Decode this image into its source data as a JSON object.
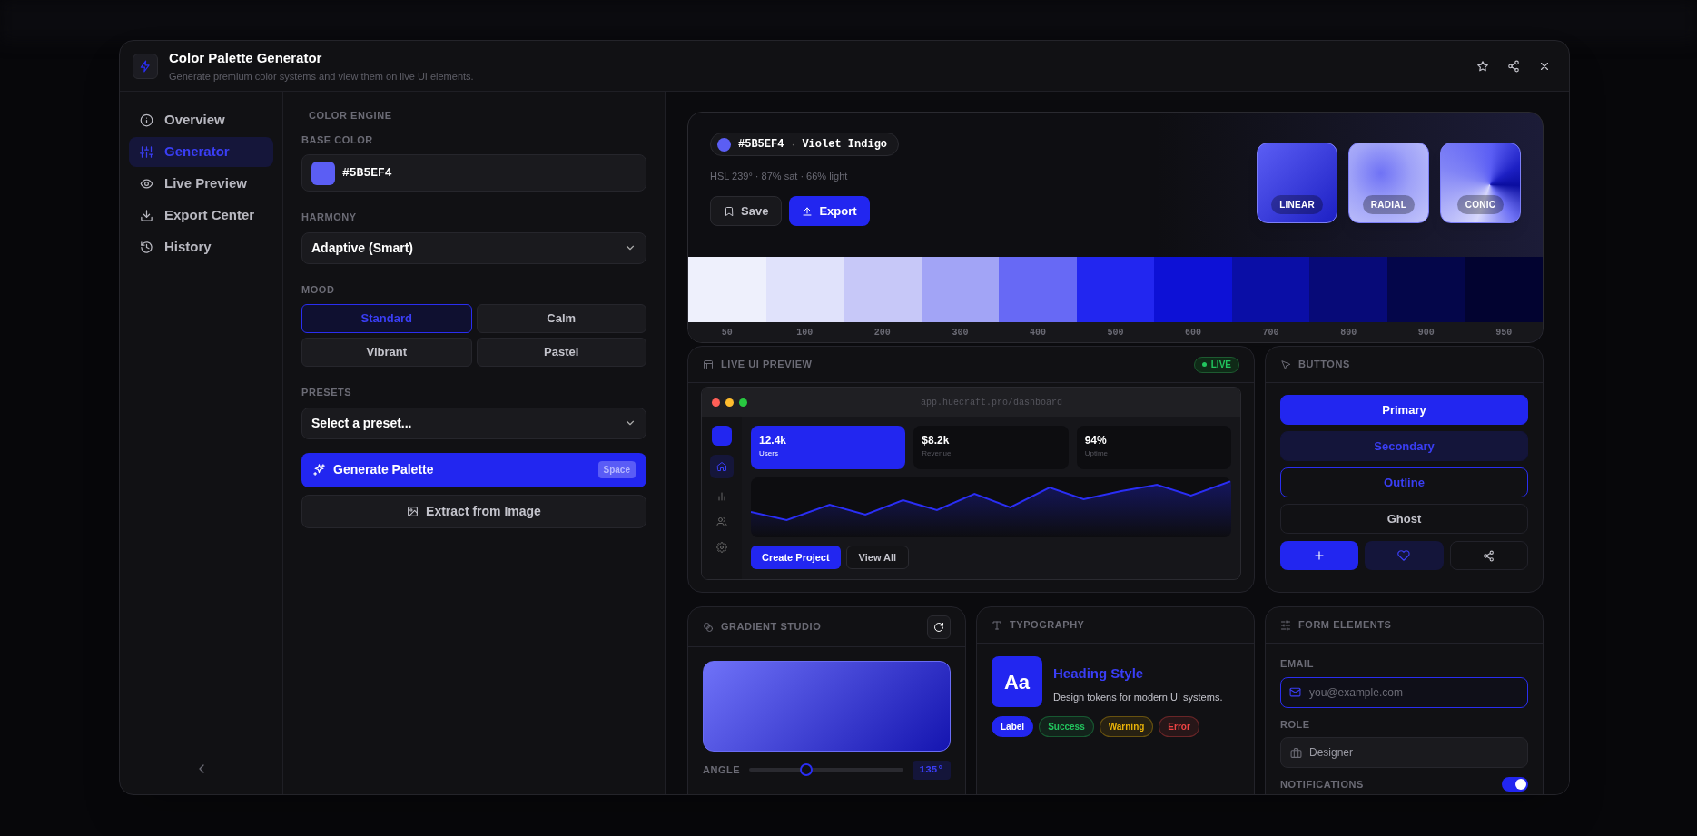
{
  "window": {
    "title": "Color Palette Generator",
    "subtitle": "Generate premium color systems and view them on live UI elements."
  },
  "sidebar": {
    "items": [
      {
        "label": "Overview",
        "selected": false
      },
      {
        "label": "Generator",
        "selected": true
      },
      {
        "label": "Live Preview",
        "selected": false
      },
      {
        "label": "Export Center",
        "selected": false
      },
      {
        "label": "History",
        "selected": false
      }
    ]
  },
  "controls": {
    "section_title": "COLOR ENGINE",
    "base_color": {
      "label": "BASE COLOR",
      "value": "#5B5EF4",
      "color": "#5b5ef4"
    },
    "harmony": {
      "label": "HARMONY",
      "value": "Adaptive (Smart)"
    },
    "mood": {
      "label": "MOOD",
      "options": [
        {
          "label": "Standard",
          "selected": true
        },
        {
          "label": "Calm",
          "selected": false
        },
        {
          "label": "Vibrant",
          "selected": false
        },
        {
          "label": "Pastel",
          "selected": false
        }
      ]
    },
    "presets": {
      "label": "PRESETS",
      "value": "Select a preset..."
    },
    "generate_button": {
      "label": "Generate Palette",
      "shortcut": "Space"
    },
    "extract_button": {
      "label": "Extract from Image"
    }
  },
  "hero": {
    "chip": {
      "hex": "#5B5EF4",
      "separator": "·",
      "name": "Violet Indigo",
      "color": "#5b5ef4"
    },
    "hsl": "HSL 239° · 87% sat · 66% light",
    "save_button": "Save",
    "export_button": "Export",
    "gradients": [
      {
        "label": "LINEAR",
        "kind": "linear"
      },
      {
        "label": "RADIAL",
        "kind": "radial"
      },
      {
        "label": "CONIC",
        "kind": "conic"
      }
    ],
    "shades": [
      {
        "label": "50",
        "color": "#eef0fc"
      },
      {
        "label": "100",
        "color": "#e0e2fb"
      },
      {
        "label": "200",
        "color": "#c7c8f8"
      },
      {
        "label": "300",
        "color": "#a2a4f6"
      },
      {
        "label": "400",
        "color": "#6769f5"
      },
      {
        "label": "500",
        "color": "#2226f0"
      },
      {
        "label": "600",
        "color": "#0d11d6"
      },
      {
        "label": "700",
        "color": "#0a0ea6"
      },
      {
        "label": "800",
        "color": "#070a78"
      },
      {
        "label": "900",
        "color": "#04064a"
      },
      {
        "label": "950",
        "color": "#020330"
      }
    ]
  },
  "live_preview": {
    "title": "LIVE UI PREVIEW",
    "badge": "LIVE",
    "url": "app.huecraft.pro/dashboard",
    "stats": [
      {
        "value": "12.4k",
        "label": "Users",
        "selected": true
      },
      {
        "value": "$8.2k",
        "label": "Revenue",
        "selected": false
      },
      {
        "value": "94%",
        "label": "Uptime",
        "selected": false
      }
    ],
    "primary_button": "Create Project",
    "secondary_button": "View All"
  },
  "buttons_card": {
    "title": "BUTTONS",
    "buttons": [
      {
        "label": "Primary",
        "kind": "primary"
      },
      {
        "label": "Secondary",
        "kind": "secondary"
      },
      {
        "label": "Outline",
        "kind": "outline"
      },
      {
        "label": "Ghost",
        "kind": "ghost"
      }
    ]
  },
  "gradient_studio": {
    "title": "GRADIENT STUDIO",
    "angle_label": "ANGLE",
    "level": 0.37,
    "reading": "135°"
  },
  "typography": {
    "title": "TYPOGRAPHY",
    "sample": "Aa",
    "heading": "Heading Style",
    "body": "Design tokens for modern UI systems.",
    "tags": [
      {
        "label": "Label",
        "color": "#2226f0"
      },
      {
        "label": "Success",
        "color": "#22c55e"
      },
      {
        "label": "Warning",
        "color": "#eab308"
      },
      {
        "label": "Error",
        "color": "#ef4444"
      }
    ]
  },
  "form": {
    "title": "FORM ELEMENTS",
    "email": {
      "label": "EMAIL",
      "placeholder": "you@example.com"
    },
    "role": {
      "label": "ROLE",
      "value": "Designer"
    },
    "notifications": {
      "label": "NOTIFICATIONS",
      "on": true
    }
  }
}
